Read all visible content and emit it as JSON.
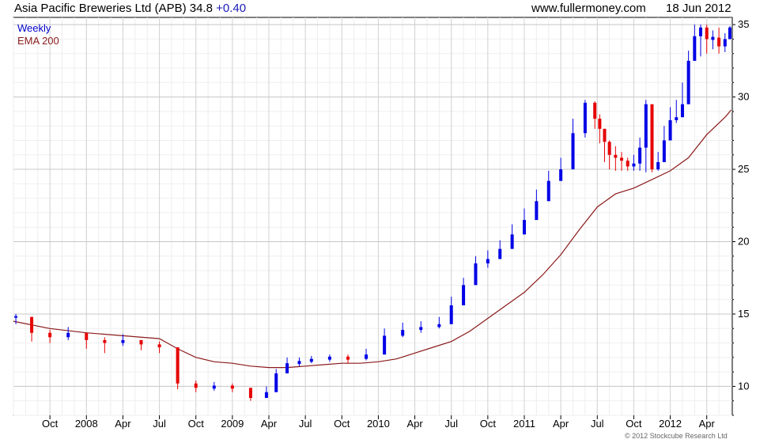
{
  "header": {
    "ticker_title": "Asia Pacific Breweries Ltd (APB) 34.8",
    "change": "+0.40",
    "source": "www.fullermoney.com",
    "date": "18 Jun 2012"
  },
  "footer": {
    "copyright": "© 2012 Stockcube Research Ltd"
  },
  "colors": {
    "up": "#0000e6",
    "down": "#e60000",
    "ema": "#8b1a1a",
    "grid": "#d3d3d3",
    "background": "#ffffff"
  },
  "chart_data": {
    "type": "line",
    "chart_style": "weekly bar chart with moving average",
    "grid": true,
    "legend_position": "top-left",
    "ylim": [
      8,
      35.5
    ],
    "y_ticks": [
      10,
      15,
      20,
      25,
      30,
      35
    ],
    "x_ticks": [
      "Oct",
      "2008",
      "Apr",
      "Jul",
      "Oct",
      "2009",
      "Apr",
      "Jul",
      "Oct",
      "2010",
      "Apr",
      "Jul",
      "Oct",
      "2011",
      "Apr",
      "Jul",
      "Oct",
      "2012",
      "Apr"
    ],
    "x_range_months": [
      0,
      59.1
    ],
    "x_tick_months": [
      3,
      6,
      9,
      12,
      15,
      18,
      21,
      24,
      27,
      30,
      33,
      36,
      39,
      42,
      45,
      48,
      51,
      54,
      57
    ],
    "series": [
      {
        "name": "Weekly",
        "kind": "price",
        "x_month": [
          0.2,
          1.5,
          3.0,
          4.5,
          6.0,
          7.5,
          9.0,
          10.5,
          12.0,
          13.5,
          15.0,
          16.5,
          18.0,
          19.5,
          20.8,
          21.6,
          22.5,
          23.5,
          24.5,
          26.0,
          27.5,
          29.0,
          30.5,
          32.0,
          33.5,
          35.0,
          36.0,
          37.0,
          38.0,
          39.0,
          40.0,
          41.0,
          42.0,
          43.0,
          44.0,
          45.0,
          46.0,
          47.0,
          47.8,
          48.2,
          48.6,
          49.0,
          49.5,
          50.0,
          50.5,
          51.0,
          51.5,
          52.0,
          52.5,
          53.0,
          53.5,
          54.0,
          54.5,
          55.0,
          55.5,
          56.0,
          56.5,
          57.0,
          57.5,
          58.0,
          58.5,
          58.9
        ],
        "y": [
          14.8,
          13.7,
          13.4,
          13.7,
          13.2,
          13.0,
          13.2,
          12.9,
          12.7,
          10.2,
          9.9,
          10.0,
          9.9,
          9.2,
          9.6,
          10.9,
          11.6,
          11.7,
          11.9,
          12.0,
          11.9,
          12.2,
          13.5,
          13.9,
          14.1,
          14.3,
          15.6,
          17.0,
          18.5,
          18.8,
          19.5,
          20.5,
          21.5,
          22.8,
          24.2,
          25.0,
          27.5,
          29.6,
          28.5,
          27.8,
          26.9,
          26.0,
          25.8,
          25.6,
          25.2,
          25.4,
          26.5,
          29.5,
          25.0,
          25.5,
          27.0,
          28.4,
          28.6,
          29.5,
          32.5,
          34.2,
          34.8,
          34.0,
          34.1,
          33.5,
          34.0,
          34.8
        ],
        "high": [
          15.0,
          14.2,
          13.9,
          14.1,
          13.7,
          13.4,
          13.6,
          13.2,
          13.1,
          10.8,
          10.4,
          10.3,
          10.2,
          9.7,
          10.0,
          11.2,
          12.0,
          12.0,
          12.1,
          12.2,
          12.2,
          12.6,
          14.0,
          14.4,
          14.5,
          14.8,
          16.2,
          17.5,
          19.0,
          19.4,
          20.1,
          21.2,
          22.3,
          23.6,
          24.9,
          25.8,
          28.5,
          29.8,
          29.7,
          28.8,
          27.8,
          27.0,
          26.6,
          26.2,
          25.8,
          26.0,
          27.2,
          29.8,
          29.2,
          26.2,
          28.0,
          29.3,
          29.8,
          31.0,
          33.2,
          35.0,
          35.0,
          35.0,
          34.6,
          34.8,
          34.4,
          34.9
        ],
        "low": [
          14.3,
          13.1,
          13.0,
          13.2,
          12.6,
          12.3,
          12.8,
          12.5,
          12.3,
          9.8,
          9.6,
          9.7,
          9.6,
          9.0,
          9.2,
          10.3,
          11.2,
          11.4,
          11.6,
          11.7,
          11.6,
          11.8,
          12.9,
          13.4,
          13.7,
          14.0,
          14.8,
          16.2,
          17.8,
          18.2,
          19.0,
          20.0,
          21.0,
          22.2,
          23.5,
          24.2,
          25.2,
          27.2,
          27.8,
          26.8,
          25.5,
          25.0,
          24.9,
          24.9,
          24.9,
          24.9,
          24.9,
          24.8,
          24.8,
          24.9,
          25.8,
          27.8,
          28.2,
          28.8,
          31.0,
          33.5,
          32.8,
          33.0,
          33.3,
          33.0,
          33.1,
          34.0
        ]
      },
      {
        "name": "EMA 200",
        "kind": "ema",
        "x_month": [
          0,
          3,
          6,
          9,
          12,
          13.5,
          15,
          16.5,
          18,
          19.5,
          21,
          22.5,
          24,
          25.5,
          27,
          28.5,
          30,
          31.5,
          33,
          34.5,
          36,
          37.5,
          39,
          40.5,
          42,
          43.5,
          45,
          46.5,
          48,
          49.5,
          51,
          52.5,
          54,
          55.5,
          57,
          58.5,
          59
        ],
        "y": [
          14.5,
          14.0,
          13.7,
          13.5,
          13.3,
          12.6,
          12.0,
          11.7,
          11.6,
          11.4,
          11.3,
          11.3,
          11.4,
          11.5,
          11.6,
          11.6,
          11.7,
          11.9,
          12.3,
          12.7,
          13.1,
          13.8,
          14.7,
          15.6,
          16.5,
          17.7,
          19.1,
          20.8,
          22.4,
          23.3,
          23.7,
          24.3,
          24.9,
          25.8,
          27.4,
          28.6,
          29.1
        ]
      }
    ]
  }
}
